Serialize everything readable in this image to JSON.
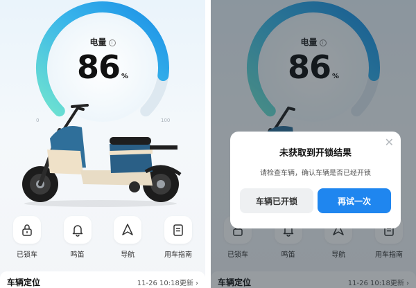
{
  "dashboard": {
    "battery_label": "电量",
    "battery_value": "86",
    "battery_unit": "%",
    "battery_level": 0.86,
    "tick_min": "0",
    "tick_max": "100"
  },
  "actions": [
    {
      "label": "已锁车",
      "icon": "lock-icon"
    },
    {
      "label": "鸣笛",
      "icon": "bell-icon"
    },
    {
      "label": "导航",
      "icon": "navigation-icon"
    },
    {
      "label": "用车指南",
      "icon": "guide-icon"
    }
  ],
  "location": {
    "title": "车辆定位",
    "updated": "11-26 10:18更新 ›"
  },
  "dialog": {
    "title": "未获取到开锁结果",
    "message": "请检查车辆，确认车辆是否已经开锁",
    "secondary_label": "车辆已开锁",
    "primary_label": "再试一次",
    "close": "✕"
  },
  "colors": {
    "accent": "#1f86ef",
    "gauge_start": "#6fe3d0",
    "gauge_end": "#1a8fe6"
  }
}
